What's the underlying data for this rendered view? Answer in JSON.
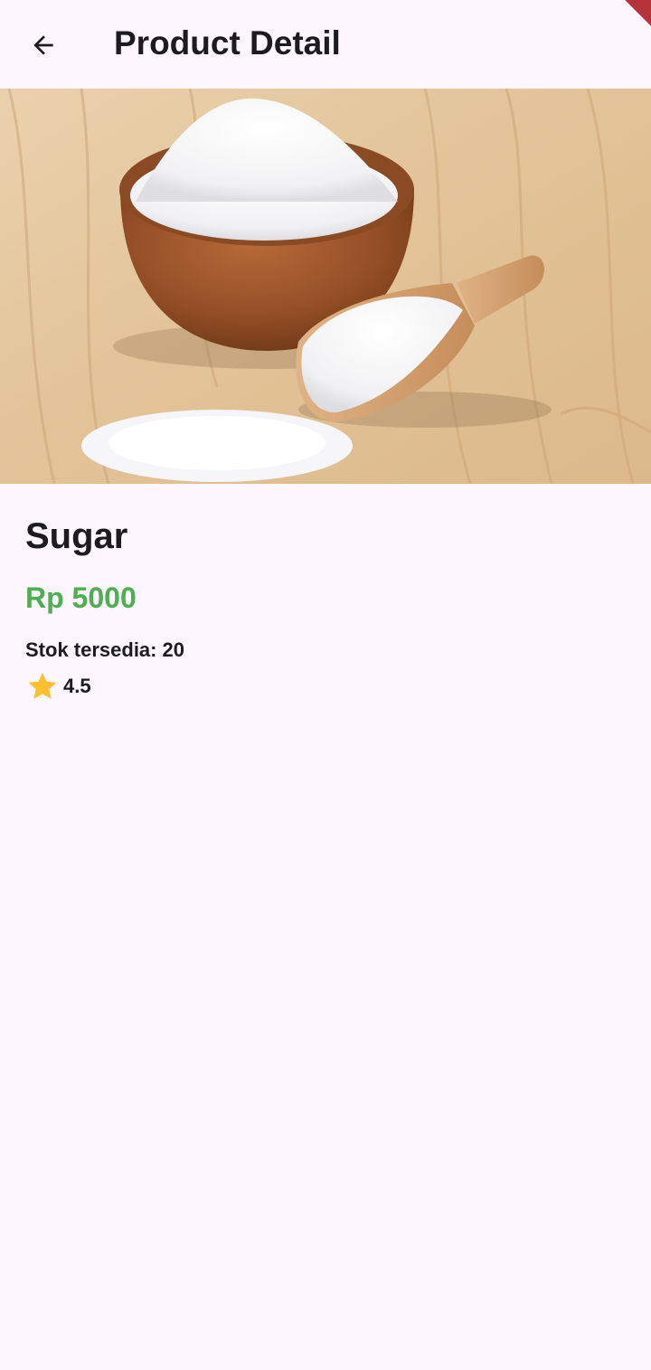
{
  "app_bar": {
    "title": "Product Detail",
    "back_icon": "arrow-back-icon"
  },
  "product": {
    "image_subject": "sugar in wooden bowl and scoop",
    "name": "Sugar",
    "price": "Rp 5000",
    "stock_label": "Stok tersedia:",
    "stock_value": "20",
    "rating_icon": "star-icon",
    "rating": "4.5"
  },
  "colors": {
    "background": "#fdf6fe",
    "price": "#4caf50",
    "star": "#fbc02d",
    "text": "#1c1b1f",
    "debug_banner": "#b5333a"
  }
}
